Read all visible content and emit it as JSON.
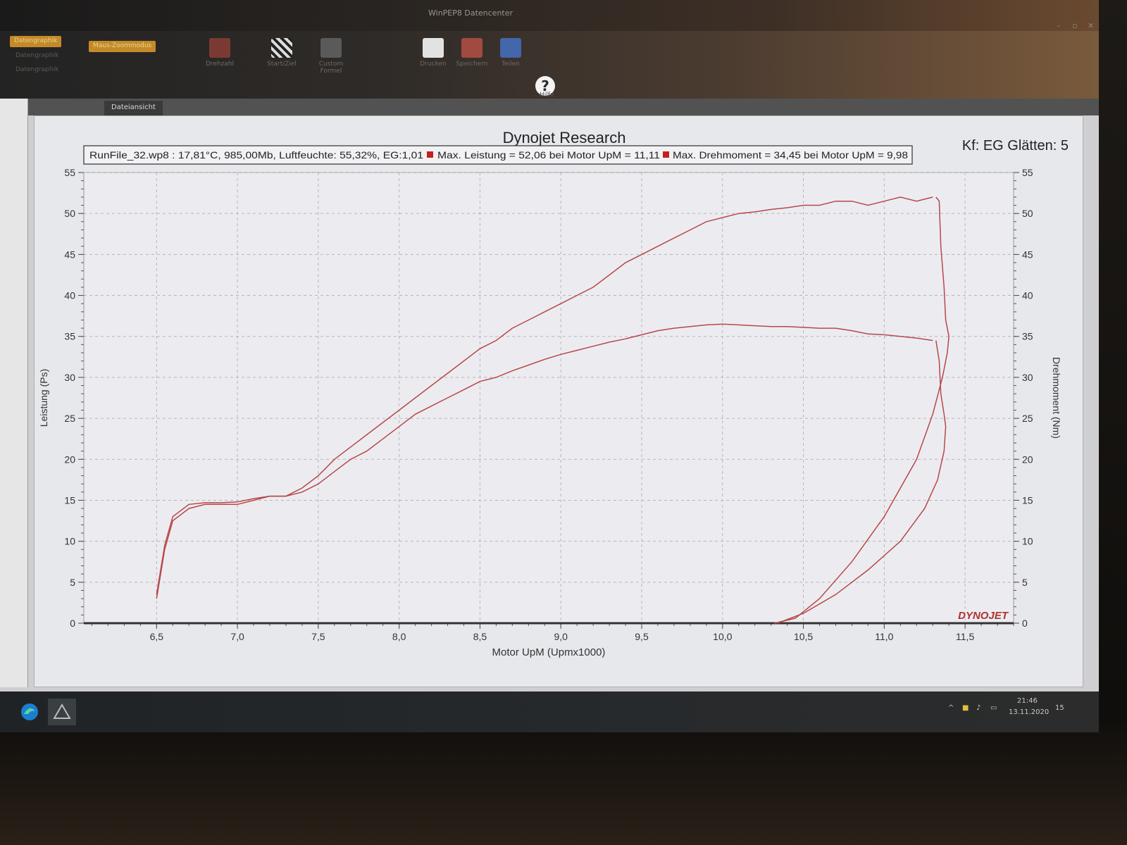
{
  "window": {
    "title": "WinPEP8 Datencenter"
  },
  "ribbon": {
    "menu_items": [
      "Datengraphik",
      "Datengraphik",
      "Datengraphik"
    ],
    "highlighted_button": "Maus-Zoommodus",
    "buttons": [
      "Drehzahl",
      "Start/Ziel",
      "Custom Formel",
      "Drucken",
      "Speichern",
      "Teilen",
      "Hilfe"
    ]
  },
  "tabs": [
    "Dateiansicht"
  ],
  "taskbar": {
    "time": "21:46",
    "date": "13.11.2020",
    "notification_count": "15"
  },
  "chart_data": {
    "type": "line",
    "title": "Dynojet Research",
    "subtitle_right": "Kf: EG Glätten: 5",
    "info_bar": {
      "run_info": "RunFile_32.wp8 : 17,81°C, 985,00Mb, Luftfeuchte: 55,32%, EG:1,01",
      "max_power": "Max. Leistung = 52,06 bei Motor UpM = 11,11",
      "max_torque": "Max. Drehmoment = 34,45 bei Motor UpM = 9,98"
    },
    "xlabel": "Motor UpM (Upmx1000)",
    "ylabel_left": "Leistung (Ps)",
    "ylabel_right": "Drehmoment (Nm)",
    "xlim": [
      6.05,
      11.8
    ],
    "ylim_left": [
      0,
      55
    ],
    "ylim_right": [
      0,
      55
    ],
    "x_ticks": [
      "6,5",
      "7,0",
      "7,5",
      "8,0",
      "8,5",
      "9,0",
      "9,5",
      "10,0",
      "10,5",
      "11,0",
      "11,5"
    ],
    "y_ticks_left": [
      "0",
      "5",
      "10",
      "15",
      "20",
      "25",
      "30",
      "35",
      "40",
      "45",
      "50",
      "55"
    ],
    "y_ticks_right": [
      "0",
      "5",
      "10",
      "15",
      "20",
      "25",
      "30",
      "35",
      "40",
      "45",
      "50",
      "55"
    ],
    "grid": true,
    "watermark": "DYNOJET",
    "colors": {
      "curve": "#b8474a",
      "background": "#e7e8ec"
    },
    "series": [
      {
        "x": [
          6.5,
          6.55,
          6.6,
          6.7,
          6.8,
          6.9,
          7.0,
          7.1,
          7.2,
          7.3,
          7.4,
          7.5,
          7.6,
          7.7,
          7.8,
          7.9,
          8.0,
          8.1,
          8.2,
          8.3,
          8.4,
          8.5,
          8.6,
          8.7,
          8.8,
          8.9,
          9.0,
          9.1,
          9.2,
          9.3,
          9.4,
          9.5,
          9.6,
          9.7,
          9.8,
          9.9,
          10.0,
          10.1,
          10.2,
          10.3,
          10.4,
          10.5,
          10.6,
          10.7,
          10.8,
          10.9,
          11.0,
          11.1,
          11.2,
          11.3
        ],
        "y": [
          3,
          9,
          12.5,
          14,
          14.5,
          14.5,
          14.5,
          15,
          15.5,
          15.5,
          16.5,
          18,
          20,
          21.5,
          23,
          24.5,
          26,
          27.5,
          29,
          30.5,
          32,
          33.5,
          34.5,
          36,
          37,
          38,
          39,
          40,
          41,
          42.5,
          44,
          45,
          46,
          47,
          48,
          49,
          49.5,
          50,
          50.2,
          50.5,
          50.7,
          51,
          51,
          51.5,
          51.5,
          51,
          51.5,
          52,
          51.5,
          52
        ]
      },
      {
        "x": [
          6.5,
          6.55,
          6.6,
          6.7,
          6.8,
          6.9,
          7.0,
          7.1,
          7.2,
          7.3,
          7.4,
          7.5,
          7.6,
          7.7,
          7.8,
          7.9,
          8.0,
          8.1,
          8.2,
          8.3,
          8.4,
          8.5,
          8.6,
          8.7,
          8.8,
          8.9,
          9.0,
          9.1,
          9.2,
          9.3,
          9.4,
          9.5,
          9.6,
          9.7,
          9.8,
          9.9,
          10.0,
          10.1,
          10.2,
          10.3,
          10.4,
          10.5,
          10.6,
          10.7,
          10.8,
          10.9,
          11.0,
          11.1,
          11.2,
          11.3
        ],
        "y": [
          3.5,
          9.5,
          13,
          14.5,
          14.7,
          14.7,
          14.8,
          15.2,
          15.5,
          15.5,
          16,
          17,
          18.5,
          20,
          21,
          22.5,
          24,
          25.5,
          26.5,
          27.5,
          28.5,
          29.5,
          30,
          30.8,
          31.5,
          32.2,
          32.8,
          33.3,
          33.8,
          34.3,
          34.7,
          35.2,
          35.7,
          36,
          36.2,
          36.4,
          36.5,
          36.4,
          36.3,
          36.2,
          36.2,
          36.1,
          36,
          36,
          35.7,
          35.3,
          35.2,
          35,
          34.8,
          34.5
        ]
      },
      {
        "x": [
          11.32,
          11.34,
          11.35,
          11.37,
          11.38,
          11.4,
          11.39,
          11.36,
          11.3,
          11.2,
          11.0,
          10.8,
          10.6,
          10.45,
          10.32
        ],
        "y": [
          52,
          51.5,
          46,
          41,
          37,
          35,
          33,
          30,
          25.5,
          20,
          13,
          7.5,
          3,
          0.6,
          0
        ]
      },
      {
        "x": [
          11.32,
          11.34,
          11.35,
          11.37,
          11.38,
          11.37,
          11.33,
          11.25,
          11.1,
          10.9,
          10.7,
          10.5,
          10.34
        ],
        "y": [
          34.5,
          32,
          28,
          25.5,
          24,
          21,
          17.5,
          14,
          10,
          6.5,
          3.5,
          1.2,
          0
        ]
      }
    ]
  }
}
